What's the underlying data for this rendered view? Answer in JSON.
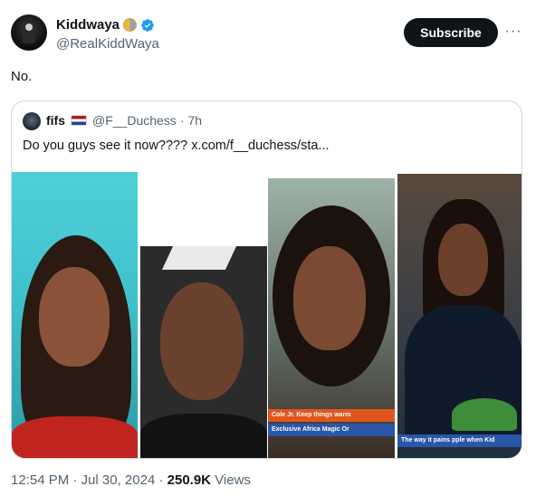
{
  "author": {
    "display_name": "Kiddwaya",
    "handle": "@RealKiddWaya",
    "badge_icon": "half-moon-icon",
    "verified_icon": "verified-badge-icon",
    "verified_color": "#1d9bf0"
  },
  "header": {
    "subscribe_label": "Subscribe",
    "more_icon": "more-horizontal-icon",
    "more_glyph": "···"
  },
  "tweet": {
    "text": "No."
  },
  "quote": {
    "display_name": "fifs",
    "flag_icon": "netherlands-flag-icon",
    "handle": "@F__Duchess",
    "separator": "·",
    "time": "7h",
    "text": "Do you guys see it now????  x.com/f__duchess/sta..."
  },
  "media": {
    "photo_count": 4,
    "captions": [
      "Cole Jr.  Keep things warm",
      "Exclusive Africa Magic Or",
      "The way it pains pple when Kid"
    ]
  },
  "footer": {
    "time": "12:54 PM",
    "separator": "·",
    "date": "Jul 30, 2024",
    "views_count": "250.9K",
    "views_label": "Views"
  },
  "colors": {
    "text": "#0f1419",
    "secondary": "#536471",
    "border": "#cfd9de",
    "button_bg": "#0f1419"
  }
}
